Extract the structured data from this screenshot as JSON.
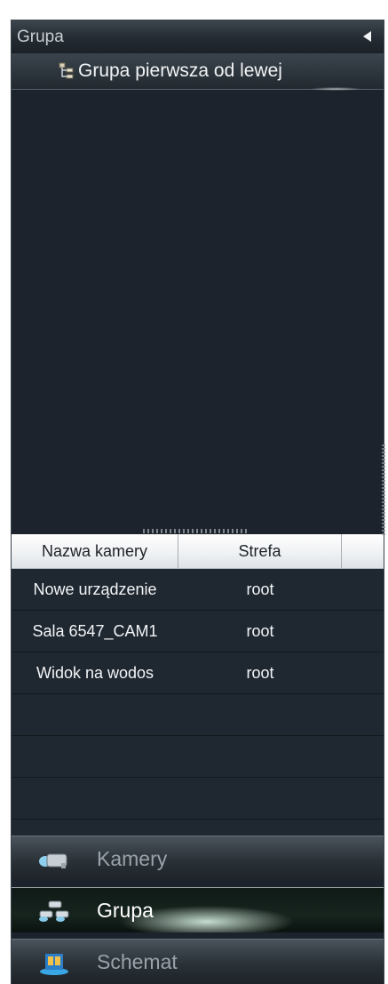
{
  "header": {
    "title": "Grupa"
  },
  "tree": {
    "root_label": "Grupa pierwsza od lewej"
  },
  "table": {
    "columns": [
      "Nazwa kamery",
      "Strefa",
      ""
    ],
    "rows": [
      {
        "name": "Nowe urządzenie",
        "zone": "root"
      },
      {
        "name": "Sala 6547_CAM1",
        "zone": "root"
      },
      {
        "name": "Widok na wodos",
        "zone": "root"
      },
      {
        "name": "",
        "zone": ""
      },
      {
        "name": "",
        "zone": ""
      },
      {
        "name": "",
        "zone": ""
      }
    ]
  },
  "nav": {
    "items": [
      {
        "label": "Kamery",
        "icon": "camera-icon"
      },
      {
        "label": "Grupa",
        "icon": "group-icon"
      },
      {
        "label": "Schemat",
        "icon": "map-icon"
      }
    ],
    "active": "Grupa"
  }
}
